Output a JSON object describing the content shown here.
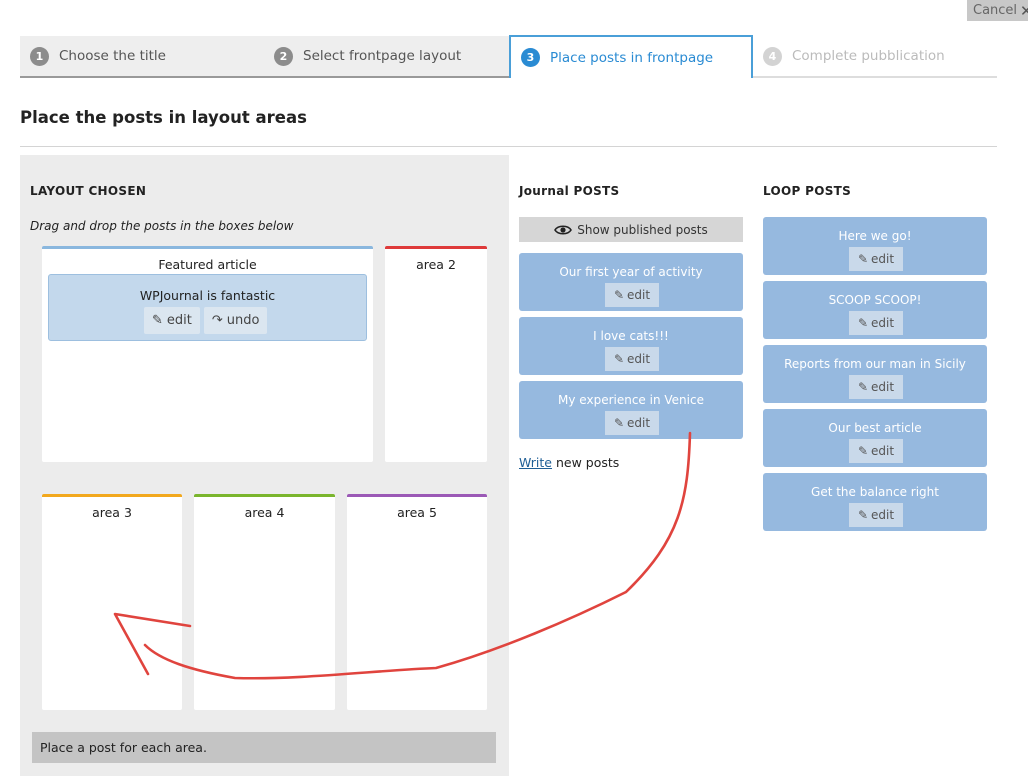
{
  "cancel": {
    "label": "Cancel"
  },
  "wizard": {
    "steps": [
      {
        "number": "1",
        "label": "Choose the title"
      },
      {
        "number": "2",
        "label": "Select frontpage layout"
      },
      {
        "number": "3",
        "label": "Place posts in frontpage"
      },
      {
        "number": "4",
        "label": "Complete pubblication"
      }
    ]
  },
  "page_title": "Place the posts in layout areas",
  "layout": {
    "heading": "LAYOUT CHOSEN",
    "instruction": "Drag and drop the posts in the boxes below",
    "areas": {
      "featured": "Featured article",
      "area2": "area 2",
      "area3": "area 3",
      "area4": "area 4",
      "area5": "area 5"
    },
    "placed_post": {
      "title": "WPJournal is fantastic",
      "edit_label": "edit",
      "undo_label": "undo"
    },
    "status": "Place a post for each area."
  },
  "journal": {
    "heading_bold": "Journal",
    "heading_rest": " POSTS",
    "show_published": "Show published posts",
    "posts": [
      {
        "title": "Our first year of activity",
        "edit_label": "edit"
      },
      {
        "title": "I love cats!!!",
        "edit_label": "edit"
      },
      {
        "title": "My experience in Venice",
        "edit_label": "edit"
      }
    ],
    "write_link": "Write",
    "write_rest": " new posts"
  },
  "loop": {
    "heading": "LOOP POSTS",
    "posts": [
      {
        "title": "Here we go!",
        "edit_label": "edit"
      },
      {
        "title": "SCOOP SCOOP!",
        "edit_label": "edit"
      },
      {
        "title": "Reports from our man in Sicily",
        "edit_label": "edit"
      },
      {
        "title": "Our best article",
        "edit_label": "edit"
      },
      {
        "title": "Get the balance right",
        "edit_label": "edit"
      }
    ]
  },
  "colors": {
    "accent": "#2a8bd3",
    "post_card": "#96b9df",
    "annotation_arrow": "#e0443e",
    "featured_border": "#8ab7de",
    "area2_border": "#de3a3a",
    "area3_border": "#f2a81d",
    "area4_border": "#7ab52d",
    "area5_border": "#9b59b6"
  }
}
